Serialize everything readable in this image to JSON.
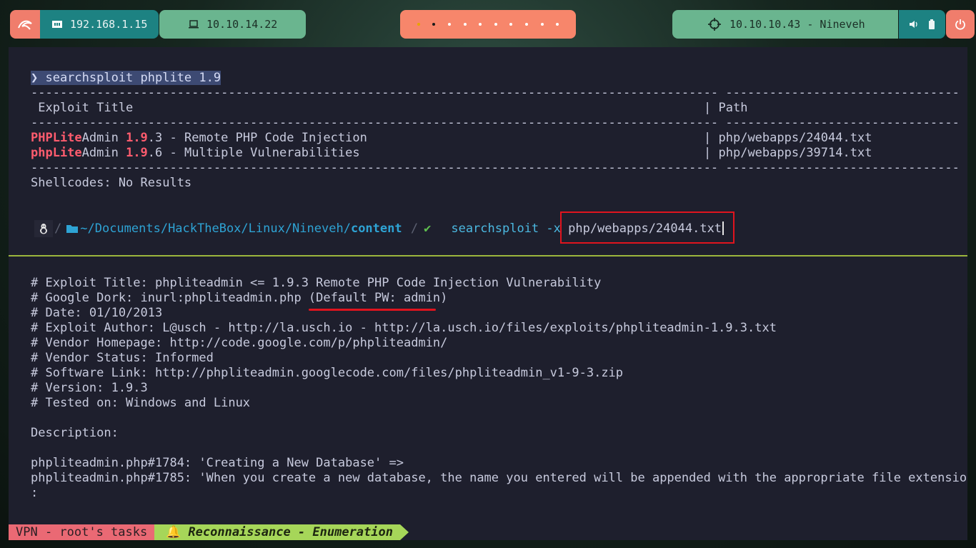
{
  "topbar": {
    "local_ip": "192.168.1.15",
    "vpn_ip": "10.10.14.22",
    "target": "10.10.10.43 - Nineveh"
  },
  "terminal": {
    "cmd1": "❯ searchsploit phplite 1.9",
    "dash_left": "----------------------------------------------------------------------------------------------",
    "dash_right": "--------------------------------",
    "header_title": " Exploit Title",
    "header_sep": "|",
    "header_path": " Path",
    "results": [
      {
        "a": "PHPLite",
        "b": "Admin ",
        "c": "1.9",
        "d": ".3 - Remote PHP Code Injection",
        "path": "php/webapps/24044.txt"
      },
      {
        "a": "phpLite",
        "b": "Admin ",
        "c": "1.9",
        "d": ".6 - Multiple Vulnerabilities",
        "path": "php/webapps/39714.txt"
      }
    ],
    "shellcodes": "Shellcodes: No Results",
    "prompt2": {
      "dir_prefix": "~/Documents/HackTheBox/Linux/Nineveh/",
      "dir_current": "content",
      "command": "searchsploit -x ",
      "arg": "php/webapps/24044.txt"
    },
    "output": [
      "# Exploit Title: phpliteadmin <= 1.9.3 Remote PHP Code Injection Vulnerability",
      "# Google Dork: inurl:phpliteadmin.php (Default PW: admin)",
      "# Date: 01/10/2013",
      "# Exploit Author: L@usch - http://la.usch.io - http://la.usch.io/files/exploits/phpliteadmin-1.9.3.txt",
      "# Vendor Homepage: http://code.google.com/p/phpliteadmin/",
      "# Vendor Status: Informed",
      "# Software Link: http://phpliteadmin.googlecode.com/files/phpliteadmin_v1-9-3.zip",
      "# Version: 1.9.3",
      "# Tested on: Windows and Linux",
      "",
      "Description:",
      "",
      "phpliteadmin.php#1784: 'Creating a New Database' =>",
      "phpliteadmin.php#1785: 'When you create a new database, the name you entered will be appended with the appropriate file extensio",
      ":"
    ]
  },
  "statusbar": {
    "left": "VPN - root's tasks",
    "task": "Reconnaissance - Enumeration"
  }
}
